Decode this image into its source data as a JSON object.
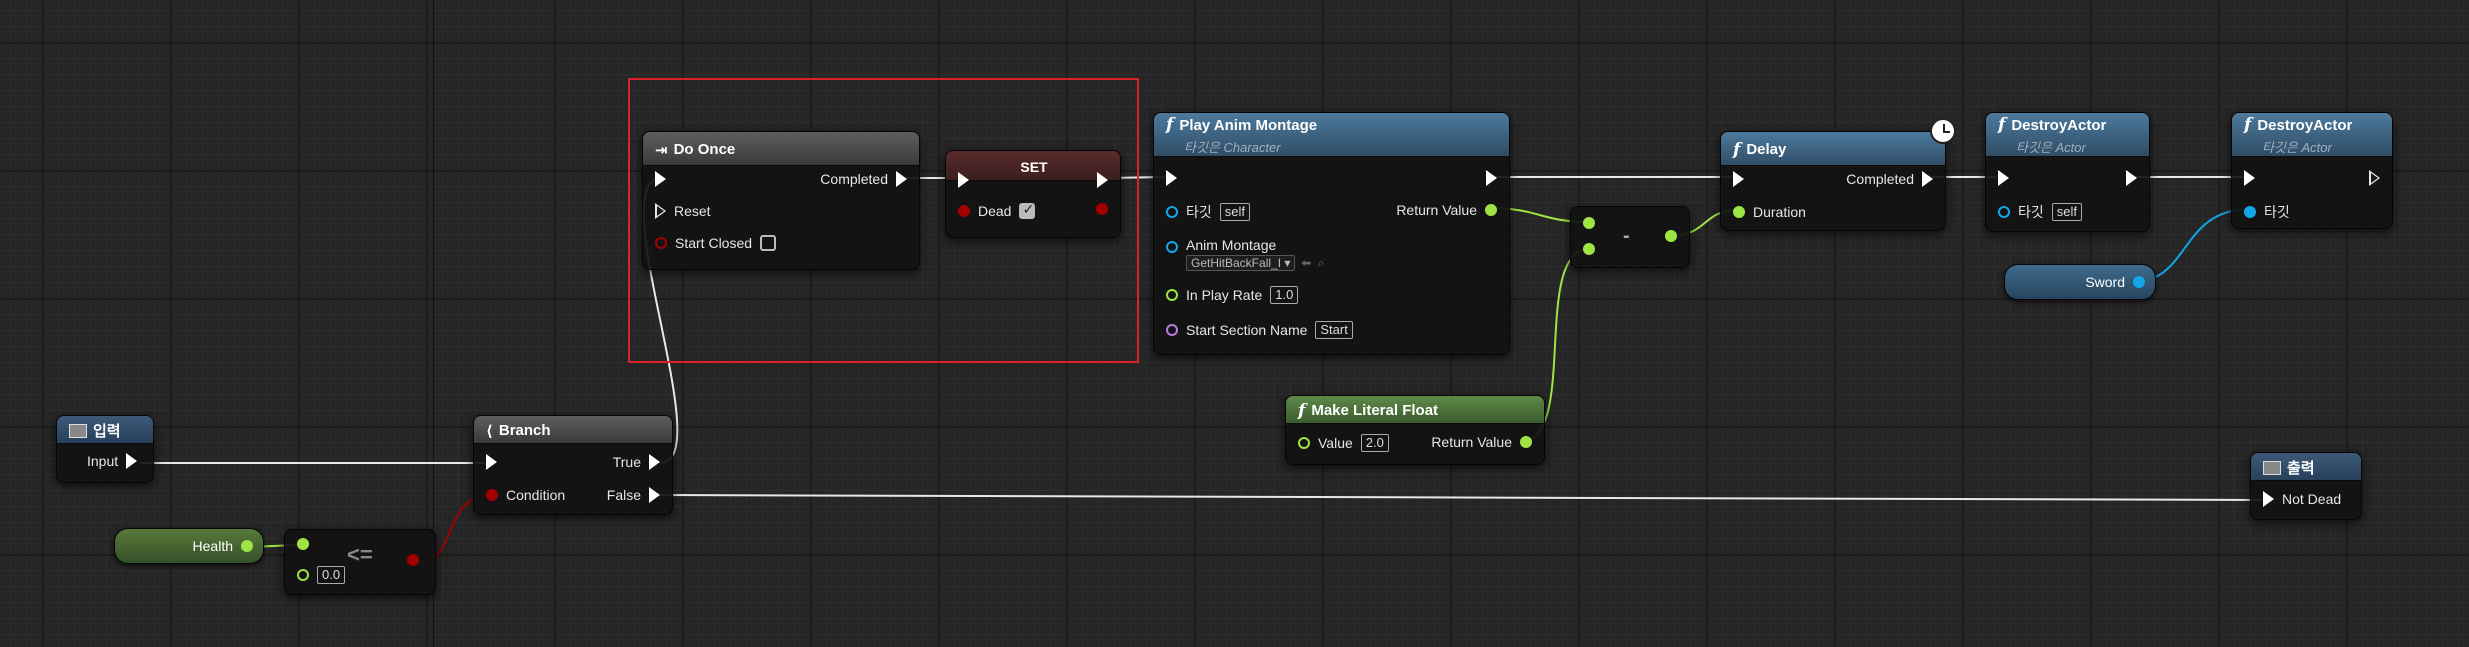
{
  "colors": {
    "exec": "#ffffff",
    "float": "#9ee544",
    "bool": "#a30000",
    "object": "#10a6e8",
    "anim": "#10a6e8",
    "name": "#b57ee0",
    "selection": "#d9232b"
  },
  "nodes": {
    "input": {
      "title": "입력",
      "pin_out": "Input"
    },
    "output": {
      "title": "출력",
      "pin_in": "Not Dead"
    },
    "do_once": {
      "title": "Do Once",
      "completed": "Completed",
      "reset": "Reset",
      "start_closed": "Start Closed",
      "start_closed_checked": false
    },
    "set": {
      "title": "SET",
      "var": "Dead",
      "checked": true
    },
    "play_anim": {
      "title": "Play Anim Montage",
      "subtitle": "타깃은 Character",
      "target": "타깃",
      "target_val": "self",
      "return": "Return Value",
      "anim_montage": "Anim Montage",
      "anim_montage_val": "GetHitBackFall_I",
      "in_play_rate": "In Play Rate",
      "in_play_rate_val": "1.0",
      "start_section": "Start Section Name",
      "start_section_val": "Start"
    },
    "delay": {
      "title": "Delay",
      "completed": "Completed",
      "duration": "Duration"
    },
    "destroy1": {
      "title": "DestroyActor",
      "subtitle": "타깃은 Actor",
      "target": "타깃",
      "target_val": "self"
    },
    "destroy2": {
      "title": "DestroyActor",
      "subtitle": "타깃은 Actor",
      "target": "타깃"
    },
    "branch": {
      "title": "Branch",
      "true": "True",
      "false": "False",
      "condition": "Condition"
    },
    "make_literal": {
      "title": "Make Literal Float",
      "value": "Value",
      "value_val": "2.0",
      "return": "Return Value"
    },
    "subtract": {
      "symbol": "-"
    },
    "compare": {
      "symbol": "<=",
      "b_val": "0.0"
    }
  },
  "variables": {
    "health": "Health",
    "sword": "Sword"
  }
}
